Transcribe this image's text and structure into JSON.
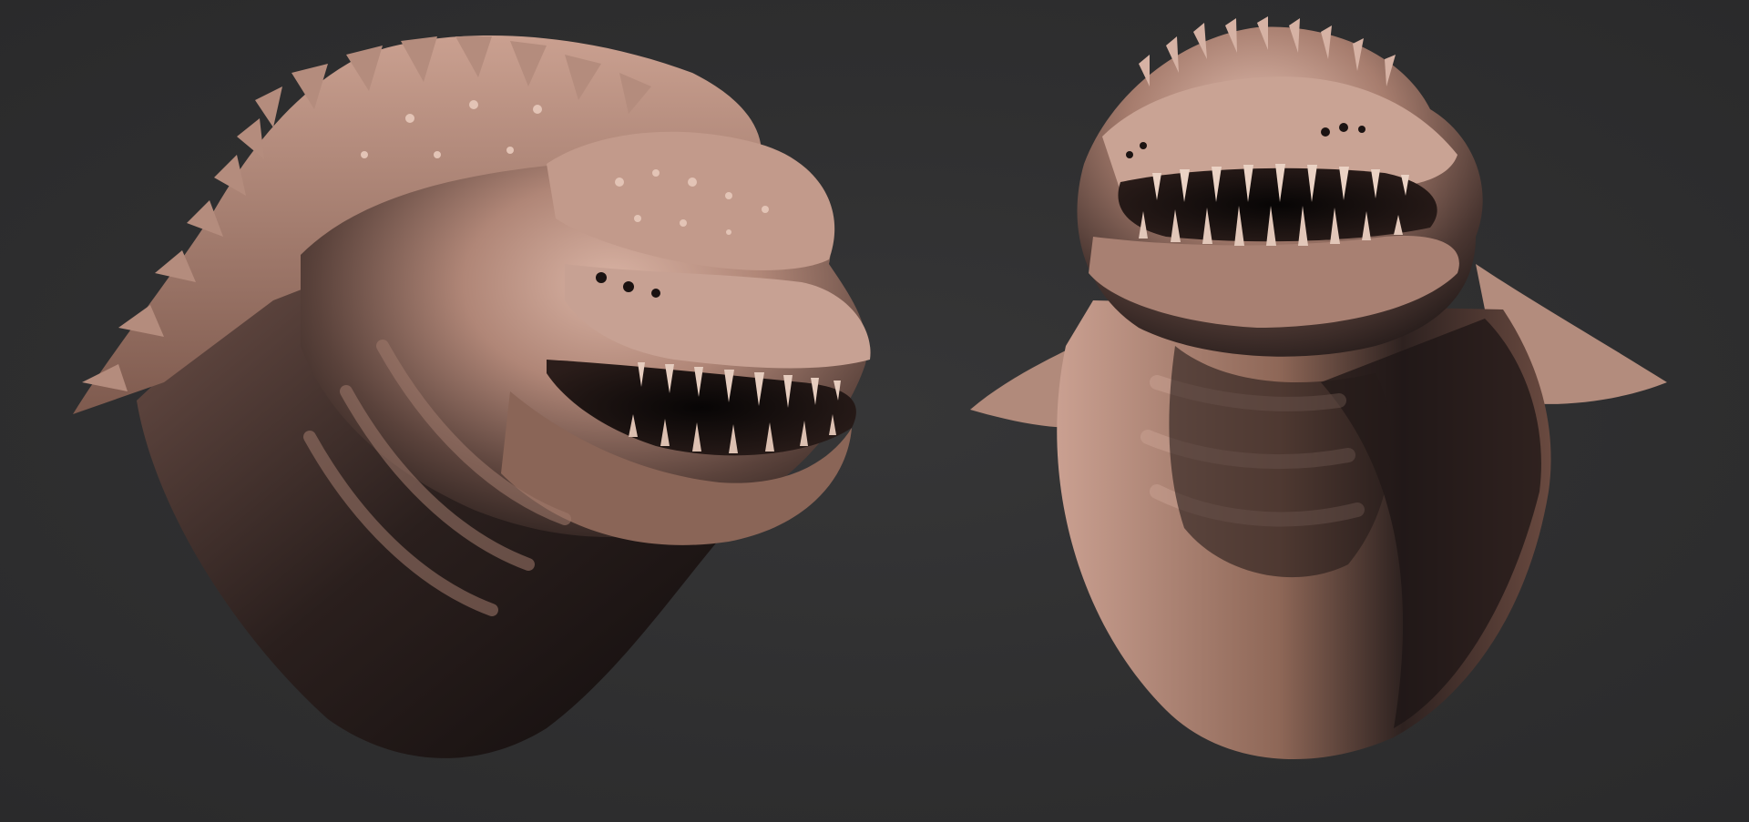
{
  "scene": {
    "background_color": "#2e2e2f",
    "clay_light": "#cfa89a",
    "clay_mid": "#9c7466",
    "clay_dark": "#3a2b27",
    "shadow": "#151111",
    "spike_color": "#e2c4b6",
    "subjects": [
      {
        "name": "creature-head-side-view"
      },
      {
        "name": "creature-head-front-view"
      }
    ]
  }
}
